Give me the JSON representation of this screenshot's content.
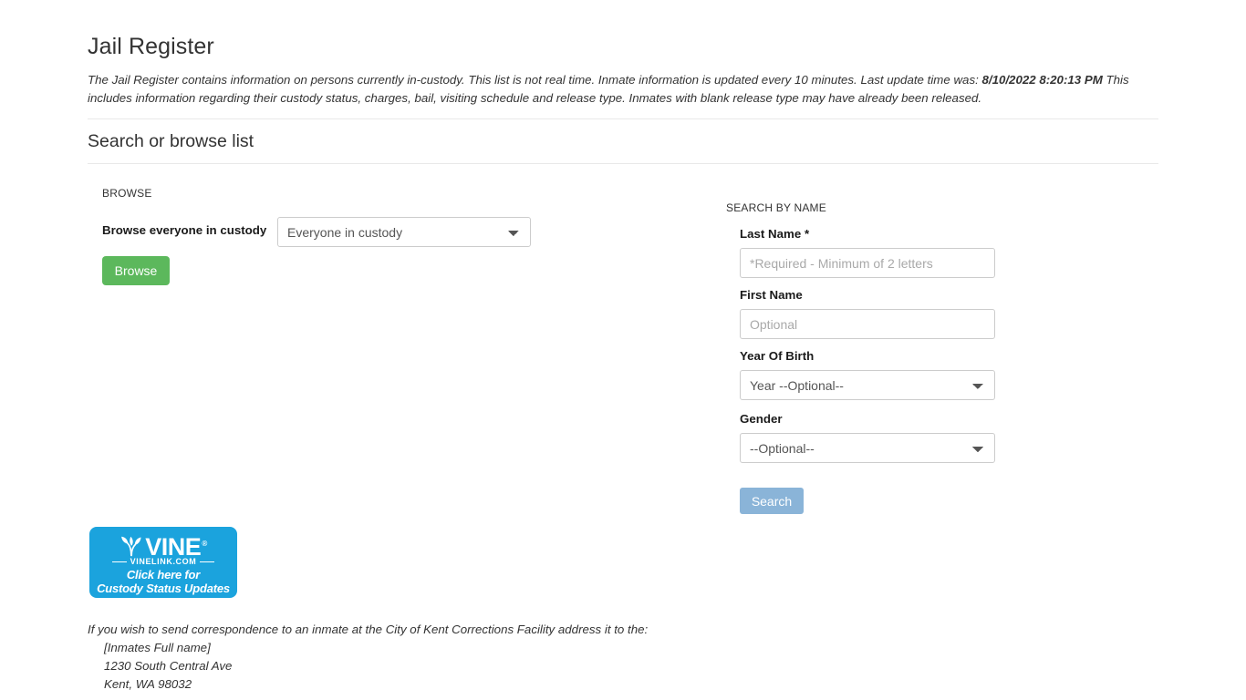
{
  "header": {
    "title": "Jail Register",
    "intro_part1": "The Jail Register contains information on persons currently in-custody. This list is not real time. Inmate information is updated every 10 minutes. Last update time was: ",
    "intro_timestamp": "8/10/2022 8:20:13 PM",
    "intro_part2": " This includes information regarding their custody status, charges, bail, visiting schedule and release type. Inmates with blank release type may have already been released."
  },
  "section": {
    "title": "Search or browse list"
  },
  "browse": {
    "caption": "BROWSE",
    "label": "Browse everyone in custody",
    "select_value": "Everyone in custody",
    "select_options": [
      "Everyone in custody"
    ],
    "button_label": "Browse",
    "button_color": "#5cb85c"
  },
  "search": {
    "caption": "SEARCH BY NAME",
    "last_name": {
      "label": "Last Name *",
      "value": "",
      "placeholder": "*Required - Minimum of 2 letters"
    },
    "first_name": {
      "label": "First Name",
      "value": "",
      "placeholder": "Optional"
    },
    "year_of_birth": {
      "label": "Year Of Birth",
      "value": "Year --Optional--",
      "options": [
        "Year --Optional--"
      ]
    },
    "gender": {
      "label": "Gender",
      "value": "--Optional--",
      "options": [
        "--Optional--"
      ]
    },
    "button_label": "Search",
    "button_color": "#8ab4d8"
  },
  "vine": {
    "wordmark": "VINE",
    "registered": "®",
    "domain": "VINELINK.COM",
    "cta_line1": "Click here for",
    "cta_line2": "Custody Status Updates",
    "background_color": "#1ba3dd",
    "icon": "sprout-icon"
  },
  "address": {
    "intro": "If you wish to send correspondence to an inmate at the City of Kent Corrections Facility address it to the:",
    "line1": "[Inmates Full name]",
    "line2": "1230 South Central Ave",
    "line3": "Kent, WA 98032"
  }
}
